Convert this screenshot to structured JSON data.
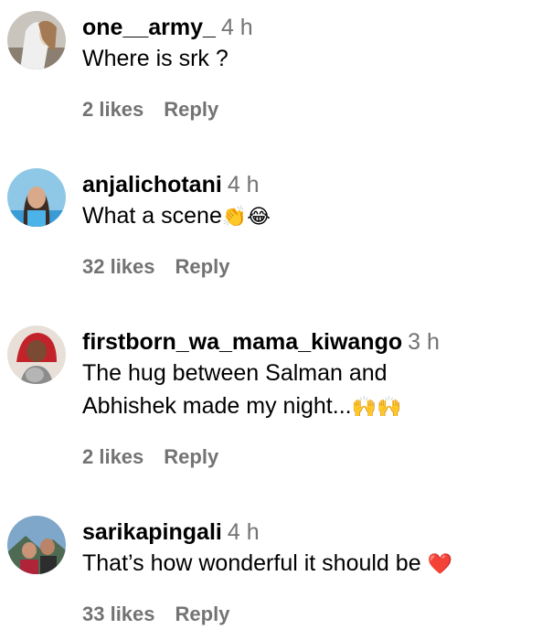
{
  "comments": [
    {
      "username": "one__army_",
      "time": "4 h",
      "text": "Where is srk ?",
      "likes": "2 likes",
      "reply": "Reply"
    },
    {
      "username": "anjalichotani",
      "time": "4 h",
      "text": "What a scene",
      "emojis": "👏😂",
      "likes": "32 likes",
      "reply": "Reply"
    },
    {
      "username": "firstborn_wa_mama_kiwango",
      "time": "3 h",
      "text_line1": "The hug between Salman and",
      "text_line2": "Abhishek made my night...",
      "emojis": "🙌🙌",
      "likes": "2 likes",
      "reply": "Reply"
    },
    {
      "username": "sarikapingali",
      "time": "4 h",
      "text": "That’s how wonderful it should be",
      "emojis": "❤️",
      "likes": "33 likes",
      "reply": "Reply"
    }
  ],
  "colors": {
    "primary_text": "#000000",
    "secondary_text": "#737373",
    "background": "#ffffff"
  }
}
